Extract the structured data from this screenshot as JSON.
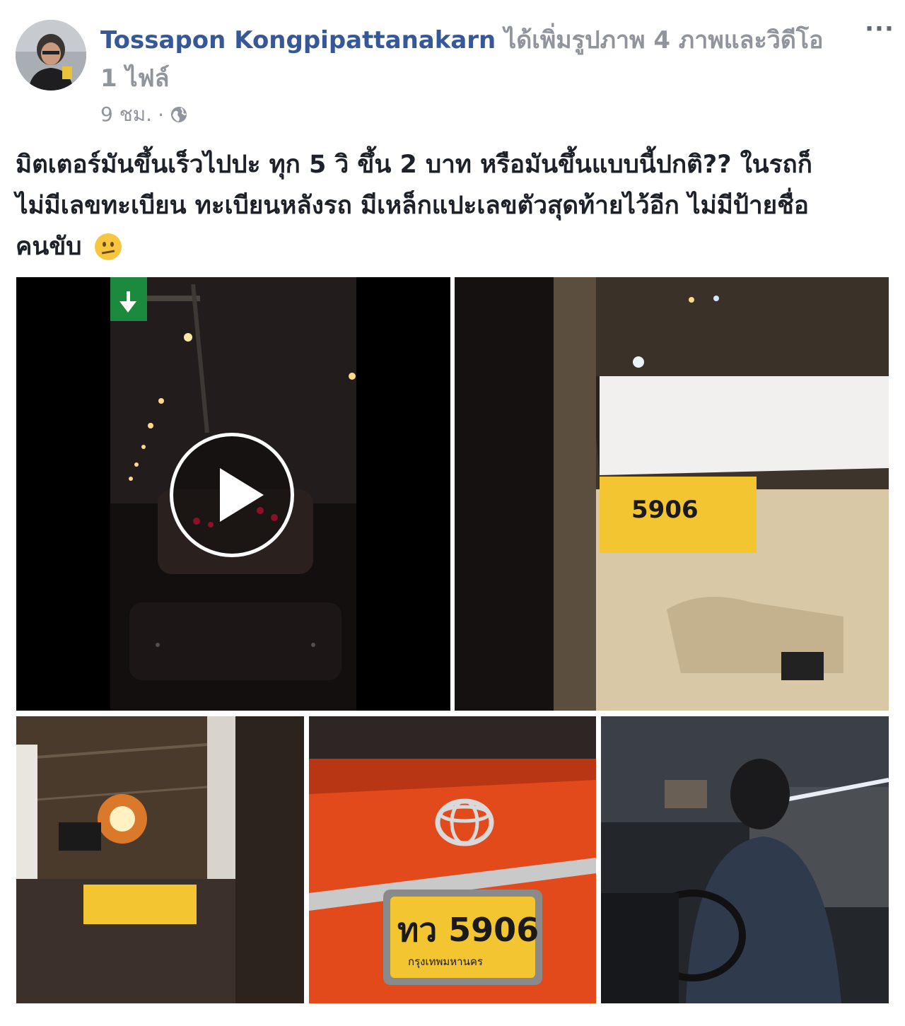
{
  "header": {
    "author": "Tossapon Kongpipattanakarn",
    "action": "ได้เพิ่มรูปภาพ 4 ภาพและวิดีโอ 1 ไฟล์",
    "time": "9 ชม.",
    "separator": "·",
    "privacy_icon": "globe-icon",
    "more_label": "···"
  },
  "post": {
    "line1": "มิตเตอร์มันขึ้นเร็วไปปะ ทุก 5 วิ ขึ้น 2 บาท หรือมันขึ้นแบบนี้ปกติ?? ในรถก็",
    "line2": "ไม่มีเลขทะเบียน ทะเบียนหลังรถ มีเหล็กแปะเลขตัวสุดท้ายไว้อีก ไม่มีป้ายชื่อ",
    "line3": "คนขับ",
    "emoji": "confused-face-emoji"
  },
  "media": {
    "video_label": "video-night-highway",
    "photos": [
      "photo-door-plate",
      "photo-window-traffic",
      "photo-rear-plate",
      "photo-driver"
    ],
    "plate_text": "ทว 5906",
    "plate_sub": "กรุงเทพมหานคร",
    "door_plate_text": "5906"
  },
  "colors": {
    "link": "#365899",
    "meta": "#90949c",
    "text": "#1d2129",
    "taxi_body": "#e24a1c",
    "plate_yellow": "#f2c531"
  }
}
